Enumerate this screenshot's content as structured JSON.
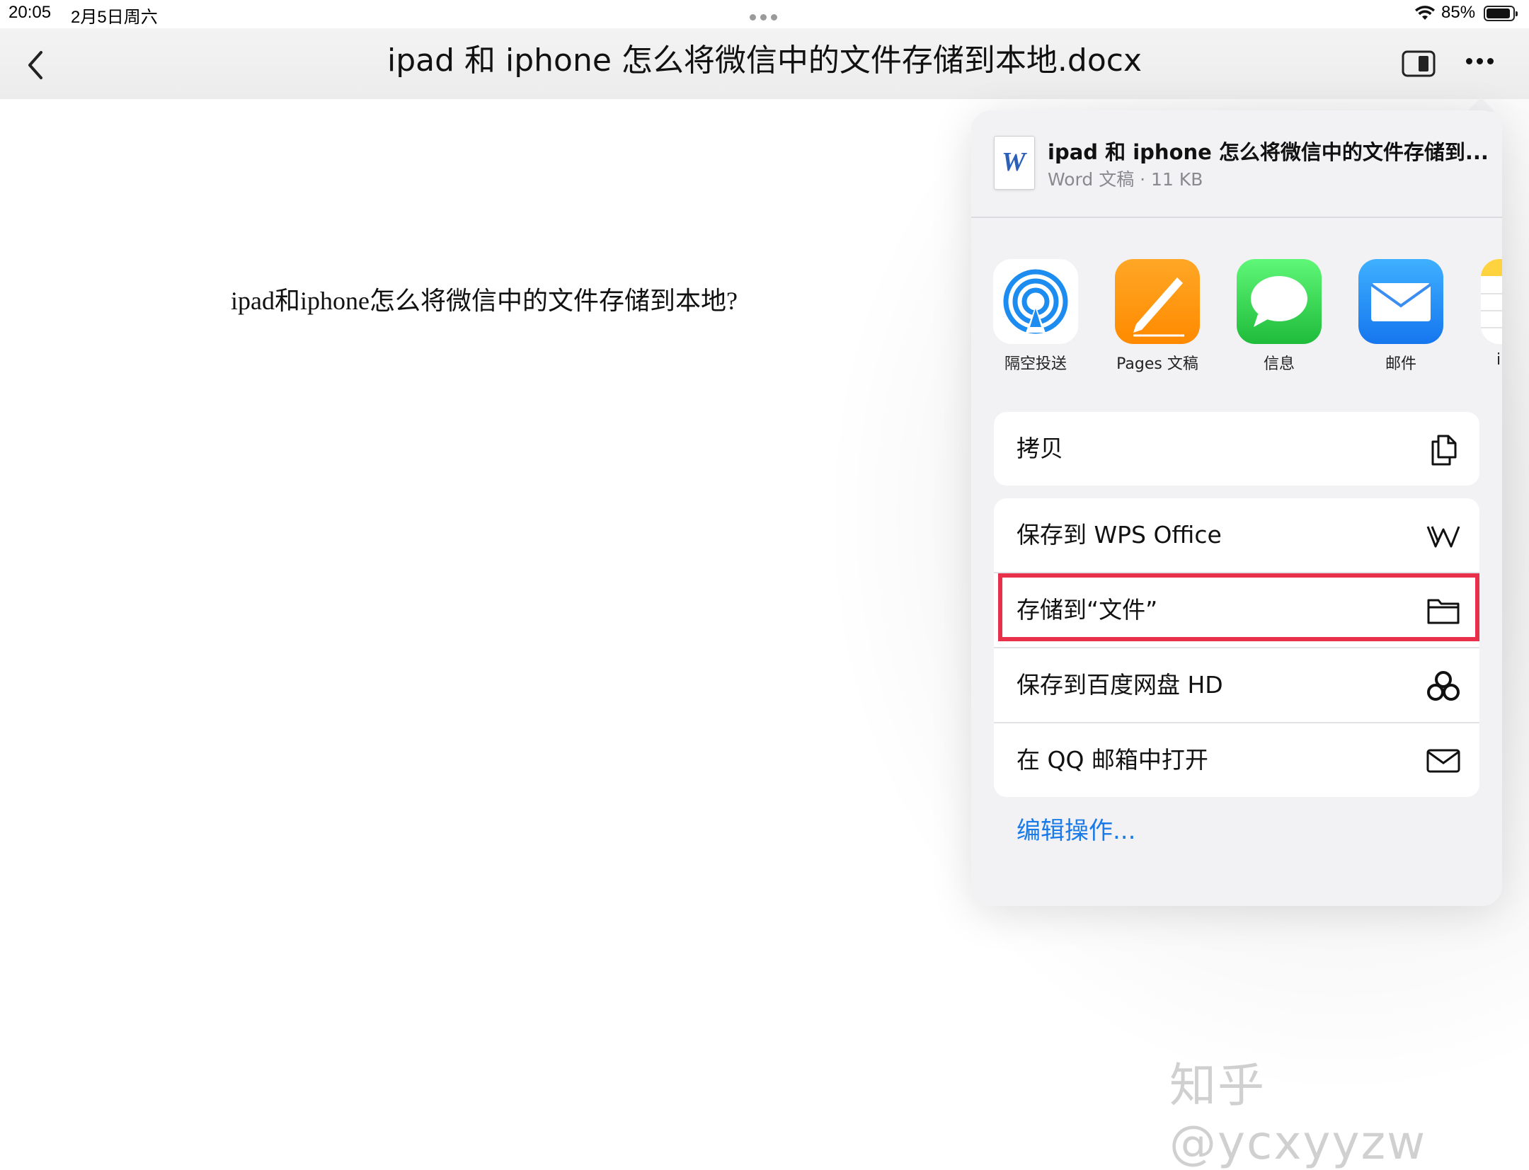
{
  "status": {
    "time": "20:05",
    "date": "2月5日周六",
    "battery": "85%"
  },
  "nav": {
    "title": "ipad 和 iphone 怎么将微信中的文件存储到本地.docx"
  },
  "document": {
    "text": "ipad和iphone怎么将微信中的文件存储到本地?"
  },
  "share": {
    "file_name": "ipad 和 iphone 怎么将微信中的文件存储到...",
    "file_meta": "Word 文稿 · 11 KB",
    "file_icon_letter": "W",
    "apps": [
      {
        "label": "隔空投送",
        "icon": "airdrop-icon"
      },
      {
        "label": "Pages 文稿",
        "icon": "pages-icon"
      },
      {
        "label": "信息",
        "icon": "messages-icon"
      },
      {
        "label": "邮件",
        "icon": "mail-icon"
      },
      {
        "label": "i",
        "icon": "notes-icon"
      }
    ],
    "actions": {
      "copy": "拷贝",
      "save_wps": "保存到 WPS Office",
      "save_files": "存储到“文件”",
      "save_baidu": "保存到百度网盘 HD",
      "open_qq": "在 QQ 邮箱中打开"
    },
    "edit_actions": "编辑操作...",
    "highlight_color": "#e8304a"
  },
  "watermark": "知乎 @ycxyyzw"
}
